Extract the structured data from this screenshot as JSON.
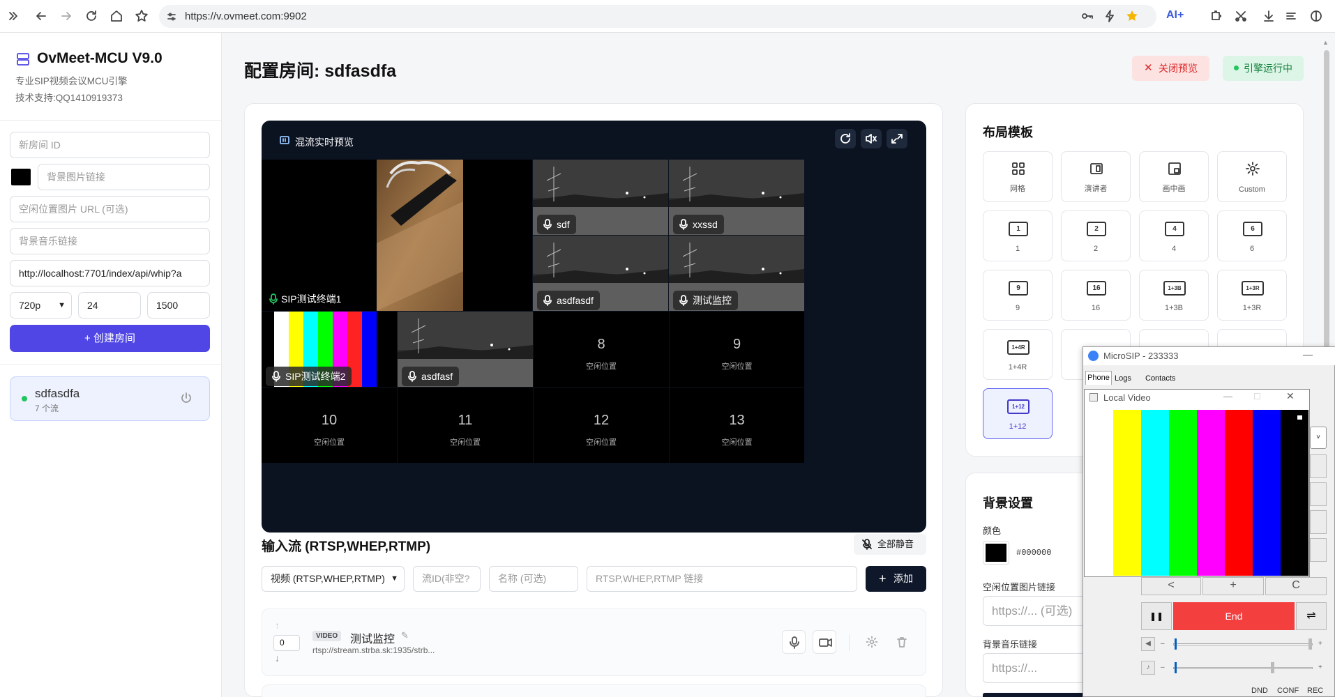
{
  "browser": {
    "url": "https://v.ovmeet.com:9902"
  },
  "sidebar": {
    "app_title": "OvMeet-MCU V9.0",
    "subtitle": "专业SIP视频会议MCU引擎",
    "support": "技术支持:QQ1410919373",
    "new_room_placeholder": "新房间 ID",
    "bg_image_placeholder": "背景图片链接",
    "idle_image_placeholder": "空闲位置图片 URL (可选)",
    "bg_music_placeholder": "背景音乐链接",
    "whip_url": "http://localhost:7701/index/api/whip?a",
    "resolution": "720p",
    "fps": "24",
    "bitrate": "1500",
    "create_button": "+ 创建房间",
    "room": {
      "name": "sdfasdfa",
      "streams": "7 个流"
    }
  },
  "main": {
    "page_title": "配置房间: sdfasdfa",
    "close_preview": "关闭预览",
    "engine_status": "引擎运行中",
    "preview_title": "混流实时预览",
    "tiles": {
      "t1": "SIP测试终端1",
      "t2": "sdf",
      "t3": "xxssd",
      "t4": "asdfasdf",
      "t5": "测试监控",
      "t6": "SIP测试终端2",
      "t7": "asdfasf"
    },
    "idle_slots": [
      {
        "num": "8",
        "label": "空闲位置"
      },
      {
        "num": "9",
        "label": "空闲位置"
      },
      {
        "num": "10",
        "label": "空闲位置"
      },
      {
        "num": "11",
        "label": "空闲位置"
      },
      {
        "num": "12",
        "label": "空闲位置"
      },
      {
        "num": "13",
        "label": "空闲位置"
      }
    ],
    "input_title": "输入流 (RTSP,WHEP,RTMP)",
    "mute_all": "全部静音",
    "type_select": "视频 (RTSP,WHEP,RTMP)",
    "stream_id_placeholder": "流ID(非空?",
    "name_placeholder": "名称 (可选)",
    "url_placeholder": "RTSP,WHEP,RTMP 链接",
    "add_button": "添加",
    "stream": {
      "order": "0",
      "badge": "VIDEO",
      "name": "测试监控",
      "url": "rtsp://stream.strba.sk:1935/strb..."
    }
  },
  "layout_panel": {
    "title": "布局模板",
    "row1": [
      {
        "label": "网格",
        "icon": "grid-icon"
      },
      {
        "label": "演讲者",
        "icon": "speaker-icon"
      },
      {
        "label": "画中画",
        "icon": "pip-icon"
      },
      {
        "label": "Custom",
        "icon": "gear-icon"
      }
    ],
    "row2": [
      {
        "box": "1",
        "label": "1"
      },
      {
        "box": "2",
        "label": "2"
      },
      {
        "box": "4",
        "label": "4"
      },
      {
        "box": "6",
        "label": "6"
      }
    ],
    "row3": [
      {
        "box": "9",
        "label": "9"
      },
      {
        "box": "16",
        "label": "16"
      },
      {
        "box": "1+3B",
        "label": "1+3B"
      },
      {
        "box": "1+3R",
        "label": "1+3R"
      }
    ],
    "row4": [
      {
        "box": "1+4R",
        "label": "1+4R"
      }
    ],
    "selected": {
      "box": "1+12",
      "label": "1+12"
    }
  },
  "bg_panel": {
    "title": "背景设置",
    "color_label": "颜色",
    "color_value": "#000000",
    "idle_image_label": "空闲位置图片链接",
    "idle_image_placeholder": "https://... (可选)",
    "music_label": "背景音乐链接",
    "music_placeholder": "https://..."
  },
  "microsip": {
    "title": "MicroSIP - 233333",
    "tabs": [
      "Phone",
      "Logs",
      "Contacts"
    ],
    "local_video_title": "Local Video",
    "end_button": "End",
    "keys": [
      "<",
      "+",
      "C"
    ],
    "status": [
      "DND",
      "CONF",
      "REC"
    ]
  },
  "colors": {
    "accent": "#4f46e5",
    "danger": "#dc2626",
    "success": "#15803d",
    "end_red": "#f43f3f"
  }
}
